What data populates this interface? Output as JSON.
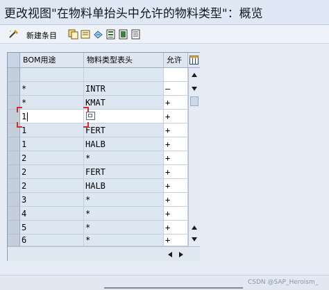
{
  "window": {
    "title": "更改视图\"在物料单抬头中允许的物料类型\"：概览"
  },
  "toolbar": {
    "new_entries_label": "新建条目",
    "icons": [
      "glasses-icon",
      "copy-icon",
      "delete-icon",
      "undo-icon",
      "select-all-icon",
      "select-block-icon",
      "deselect-all-icon"
    ]
  },
  "table": {
    "columns": [
      "BOM用途",
      "物料类型表头",
      "允许"
    ],
    "rows": [
      {
        "usage": "",
        "material_type": "",
        "allowed": ""
      },
      {
        "usage": "*",
        "material_type": "INTR",
        "allowed": "–"
      },
      {
        "usage": "*",
        "material_type": "KMAT",
        "allowed": "+"
      },
      {
        "usage": "1",
        "material_type": "",
        "allowed": "+"
      },
      {
        "usage": "1",
        "material_type": "FERT",
        "allowed": "+"
      },
      {
        "usage": "1",
        "material_type": "HALB",
        "allowed": "+"
      },
      {
        "usage": "2",
        "material_type": "*",
        "allowed": "+"
      },
      {
        "usage": "2",
        "material_type": "FERT",
        "allowed": "+"
      },
      {
        "usage": "2",
        "material_type": "HALB",
        "allowed": "+"
      },
      {
        "usage": "3",
        "material_type": "*",
        "allowed": "+"
      },
      {
        "usage": "4",
        "material_type": "*",
        "allowed": "+"
      },
      {
        "usage": "5",
        "material_type": "*",
        "allowed": "+"
      },
      {
        "usage": "6",
        "material_type": "*",
        "allowed": "+"
      }
    ]
  },
  "watermark": "CSDN @SAP_Heroism_",
  "colors": {
    "grid_readonly": "#dce7f2",
    "grid_editable": "#ffffff",
    "focus_marker": "#d22c2c"
  }
}
